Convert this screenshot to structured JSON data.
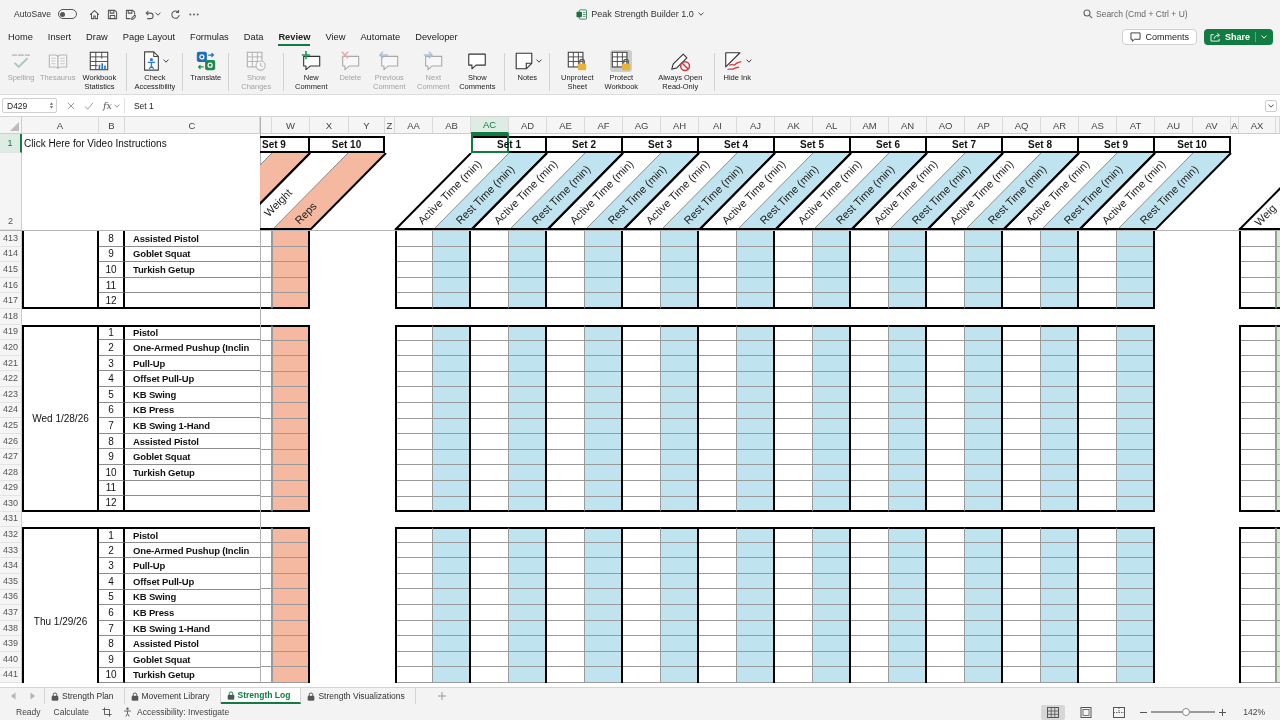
{
  "title_bar": {
    "autosave_label": "AutoSave",
    "autosave_on": false,
    "document_title": "Peak Strength Builder 1.0",
    "search_placeholder": "Search (Cmd + Ctrl + U)"
  },
  "ribbon_tabs": [
    {
      "label": "Home",
      "selected": false
    },
    {
      "label": "Insert",
      "selected": false
    },
    {
      "label": "Draw",
      "selected": false
    },
    {
      "label": "Page Layout",
      "selected": false
    },
    {
      "label": "Formulas",
      "selected": false
    },
    {
      "label": "Data",
      "selected": false
    },
    {
      "label": "Review",
      "selected": true
    },
    {
      "label": "View",
      "selected": false
    },
    {
      "label": "Automate",
      "selected": false
    },
    {
      "label": "Developer",
      "selected": false
    }
  ],
  "header_buttons": {
    "comments": "Comments",
    "share": "Share"
  },
  "ribbon_groups": [
    {
      "commands": [
        {
          "label": "Spelling",
          "disabled": true,
          "pressed": false,
          "dropdown": false
        },
        {
          "label": "Thesaurus",
          "disabled": true,
          "pressed": false,
          "dropdown": false
        },
        {
          "label": "Workbook Statistics",
          "disabled": false,
          "pressed": false,
          "dropdown": false
        }
      ]
    },
    {
      "commands": [
        {
          "label": "Check Accessibility",
          "disabled": false,
          "pressed": false,
          "dropdown": true
        }
      ]
    },
    {
      "commands": [
        {
          "label": "Translate",
          "disabled": false,
          "pressed": false,
          "dropdown": false
        }
      ]
    },
    {
      "commands": [
        {
          "label": "Show Changes",
          "disabled": true,
          "pressed": false,
          "dropdown": false
        }
      ]
    },
    {
      "commands": [
        {
          "label": "New Comment",
          "disabled": false,
          "pressed": false,
          "dropdown": false
        },
        {
          "label": "Delete",
          "disabled": true,
          "pressed": false,
          "dropdown": false
        },
        {
          "label": "Previous Comment",
          "disabled": true,
          "pressed": false,
          "dropdown": false
        },
        {
          "label": "Next Comment",
          "disabled": true,
          "pressed": false,
          "dropdown": false
        },
        {
          "label": "Show Comments",
          "disabled": false,
          "pressed": false,
          "dropdown": false
        }
      ]
    },
    {
      "commands": [
        {
          "label": "Notes",
          "disabled": false,
          "pressed": false,
          "dropdown": true
        }
      ]
    },
    {
      "commands": [
        {
          "label": "Unprotect Sheet",
          "disabled": false,
          "pressed": false,
          "dropdown": false
        },
        {
          "label": "Protect Workbook",
          "disabled": false,
          "pressed": true,
          "dropdown": false
        },
        {
          "label": "Always Open Read-Only",
          "disabled": false,
          "pressed": false,
          "dropdown": false
        }
      ]
    },
    {
      "commands": [
        {
          "label": "Hide Ink",
          "disabled": false,
          "pressed": false,
          "dropdown": true
        }
      ]
    }
  ],
  "formula_bar": {
    "name_box": "D429",
    "function_label": "fx",
    "formula": "Set 1"
  },
  "sheet": {
    "column_headers": [
      {
        "label": "A",
        "selected": false
      },
      {
        "label": "B",
        "selected": false
      },
      {
        "label": "C",
        "selected": false
      },
      {
        "label": "W",
        "selected": false
      },
      {
        "label": "X",
        "selected": false
      },
      {
        "label": "Y",
        "selected": false
      },
      {
        "label": "Z",
        "selected": false
      },
      {
        "label": "AA",
        "selected": false
      },
      {
        "label": "AB",
        "selected": false
      },
      {
        "label": "AC",
        "selected": true
      },
      {
        "label": "AD",
        "selected": false
      },
      {
        "label": "AE",
        "selected": false
      },
      {
        "label": "AF",
        "selected": false
      },
      {
        "label": "AG",
        "selected": false
      },
      {
        "label": "AH",
        "selected": false
      },
      {
        "label": "AI",
        "selected": false
      },
      {
        "label": "AJ",
        "selected": false
      },
      {
        "label": "AK",
        "selected": false
      },
      {
        "label": "AL",
        "selected": false
      },
      {
        "label": "AM",
        "selected": false
      },
      {
        "label": "AN",
        "selected": false
      },
      {
        "label": "AO",
        "selected": false
      },
      {
        "label": "AP",
        "selected": false
      },
      {
        "label": "AQ",
        "selected": false
      },
      {
        "label": "AR",
        "selected": false
      },
      {
        "label": "AS",
        "selected": false
      },
      {
        "label": "AT",
        "selected": false
      },
      {
        "label": "AU",
        "selected": false
      },
      {
        "label": "AV",
        "selected": false
      },
      {
        "label": "A",
        "selected": false
      },
      {
        "label": "AX",
        "selected": false
      }
    ],
    "row_headers": [
      {
        "label": "1",
        "selected": true
      },
      {
        "label": "2",
        "selected": false
      },
      {
        "label": "413",
        "selected": false
      },
      {
        "label": "414",
        "selected": false
      },
      {
        "label": "415",
        "selected": false
      },
      {
        "label": "416",
        "selected": false
      },
      {
        "label": "417",
        "selected": false
      },
      {
        "label": "418",
        "selected": false
      },
      {
        "label": "419",
        "selected": false
      },
      {
        "label": "420",
        "selected": false
      },
      {
        "label": "421",
        "selected": false
      },
      {
        "label": "422",
        "selected": false
      },
      {
        "label": "423",
        "selected": false
      },
      {
        "label": "424",
        "selected": false
      },
      {
        "label": "425",
        "selected": false
      },
      {
        "label": "426",
        "selected": false
      },
      {
        "label": "427",
        "selected": false
      },
      {
        "label": "428",
        "selected": false
      },
      {
        "label": "429",
        "selected": false
      },
      {
        "label": "430",
        "selected": false
      },
      {
        "label": "431",
        "selected": false
      },
      {
        "label": "432",
        "selected": false
      },
      {
        "label": "433",
        "selected": false
      },
      {
        "label": "434",
        "selected": false
      },
      {
        "label": "435",
        "selected": false
      },
      {
        "label": "436",
        "selected": false
      },
      {
        "label": "437",
        "selected": false
      },
      {
        "label": "438",
        "selected": false
      },
      {
        "label": "439",
        "selected": false
      },
      {
        "label": "440",
        "selected": false
      },
      {
        "label": "441",
        "selected": false
      }
    ],
    "instructions_link": "Click Here for Video Instructions",
    "strength_sets": [
      {
        "label": "Set 9"
      },
      {
        "label": "Set 10",
        "headers": [
          "Weight",
          "Reps"
        ]
      }
    ],
    "time_sets": [
      {
        "label": "Set 1",
        "headers": [
          "Active Time (min)",
          "Rest Time (min)"
        ]
      },
      {
        "label": "Set 2",
        "headers": [
          "Active Time (min)",
          "Rest Time (min)"
        ]
      },
      {
        "label": "Set 3",
        "headers": [
          "Active Time (min)",
          "Rest Time (min)"
        ]
      },
      {
        "label": "Set 4",
        "headers": [
          "Active Time (min)",
          "Rest Time (min)"
        ]
      },
      {
        "label": "Set 5",
        "headers": [
          "Active Time (min)",
          "Rest Time (min)"
        ]
      },
      {
        "label": "Set 6",
        "headers": [
          "Active Time (min)",
          "Rest Time (min)"
        ]
      },
      {
        "label": "Set 7",
        "headers": [
          "Active Time (min)",
          "Rest Time (min)"
        ]
      },
      {
        "label": "Set 8",
        "headers": [
          "Active Time (min)",
          "Rest Time (min)"
        ]
      },
      {
        "label": "Set 9",
        "headers": [
          "Active Time (min)",
          "Rest Time (min)"
        ]
      },
      {
        "label": "Set 10",
        "headers": [
          "Active Time (min)",
          "Rest Time (min)"
        ]
      }
    ],
    "next_section_header": "Weig",
    "log_blocks": [
      {
        "exercises": [
          {
            "number": "8",
            "name": "Assisted Pistol"
          },
          {
            "number": "9",
            "name": "Goblet Squat"
          },
          {
            "number": "10",
            "name": "Turkish Getup"
          },
          {
            "number": "11"
          },
          {
            "number": "12"
          }
        ]
      },
      {
        "day": "Wed 1/28/26",
        "exercises": [
          {
            "number": "1",
            "name": "Pistol"
          },
          {
            "number": "2",
            "name": "One-Armed Pushup (Inclin"
          },
          {
            "number": "3",
            "name": "Pull-Up"
          },
          {
            "number": "4",
            "name": "Offset Pull-Up"
          },
          {
            "number": "5",
            "name": "KB Swing"
          },
          {
            "number": "6",
            "name": "KB Press"
          },
          {
            "number": "7",
            "name": "KB Swing 1-Hand"
          },
          {
            "number": "8",
            "name": "Assisted Pistol"
          },
          {
            "number": "9",
            "name": "Goblet Squat"
          },
          {
            "number": "10",
            "name": "Turkish Getup"
          },
          {
            "number": "11"
          },
          {
            "number": "12"
          }
        ]
      },
      {
        "day": "Thu 1/29/26",
        "exercises": [
          {
            "number": "1",
            "name": "Pistol"
          },
          {
            "number": "2",
            "name": "One-Armed Pushup (Inclin"
          },
          {
            "number": "3",
            "name": "Pull-Up"
          },
          {
            "number": "4",
            "name": "Offset Pull-Up"
          },
          {
            "number": "5",
            "name": "KB Swing"
          },
          {
            "number": "6",
            "name": "KB Press"
          },
          {
            "number": "7",
            "name": "KB Swing 1-Hand"
          },
          {
            "number": "8",
            "name": "Assisted Pistol"
          },
          {
            "number": "9",
            "name": "Goblet Squat"
          },
          {
            "number": "10",
            "name": "Turkish Getup"
          }
        ]
      }
    ]
  },
  "sheet_tabs": [
    {
      "label": "Strength Plan",
      "selected": false,
      "locked": true
    },
    {
      "label": "Movement Library",
      "selected": false,
      "locked": true
    },
    {
      "label": "Strength Log",
      "selected": true,
      "locked": true
    },
    {
      "label": "Strength Visualizations",
      "selected": false,
      "locked": true
    }
  ],
  "status_bar": {
    "mode": "Ready",
    "calculate": "Calculate",
    "accessibility": "Accessibility: Investigate",
    "view_buttons": [
      {
        "selected": true
      },
      {
        "selected": false
      },
      {
        "selected": false
      }
    ],
    "zoom": {
      "level": 0.54,
      "label": "142%"
    }
  }
}
